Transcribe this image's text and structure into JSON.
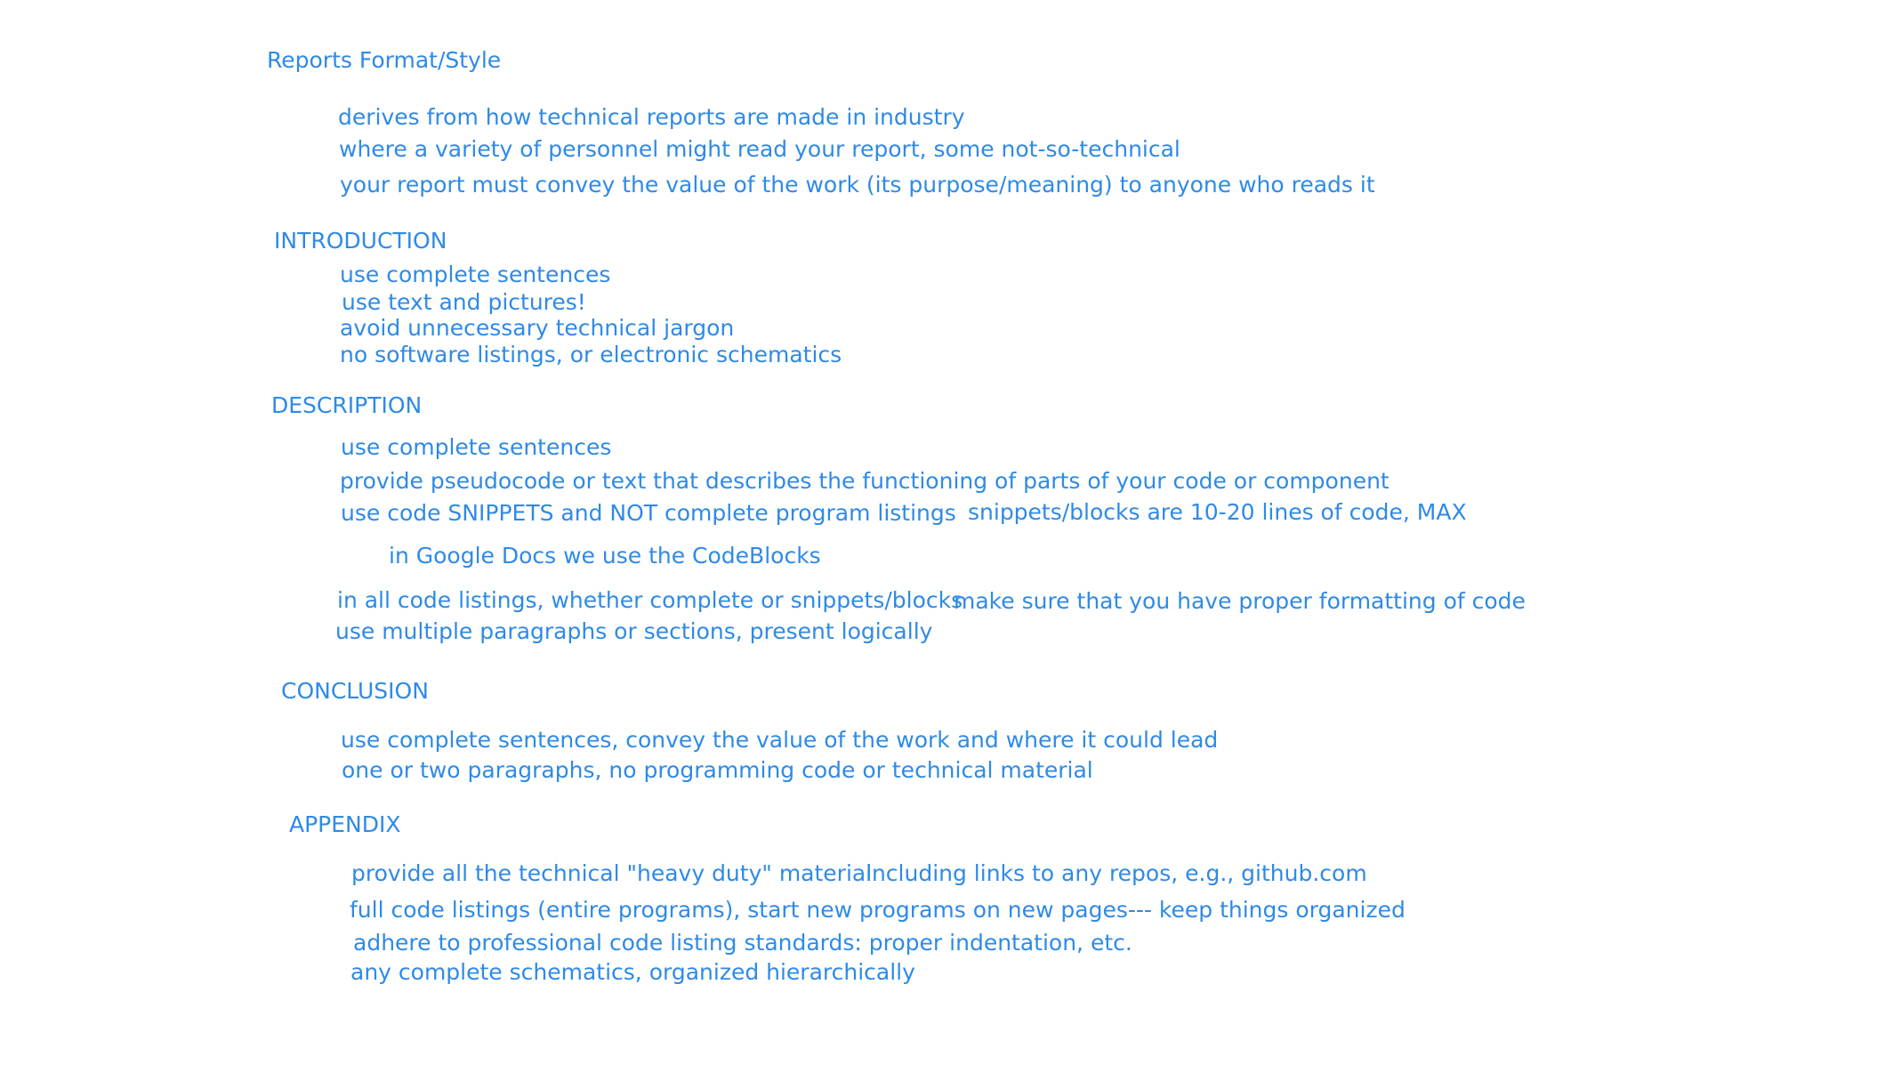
{
  "colors": {
    "text": "#2f8ae6",
    "background": "#ffffff"
  },
  "title": "Reports Format/Style",
  "intro_notes": [
    "derives from how technical reports are made in industry",
    "where a variety of personnel might read your report, some not-so-technical",
    "your report must convey the value of the work (its purpose/meaning) to anyone who reads it"
  ],
  "introduction": {
    "heading": "INTRODUCTION",
    "items": [
      "use complete sentences",
      "use text and pictures!",
      "avoid unnecessary technical jargon",
      "no software listings, or electronic schematics"
    ]
  },
  "description": {
    "heading": "DESCRIPTION",
    "items": [
      "use complete sentences",
      "provide pseudocode or text that describes the functioning of parts of your code or component",
      "use code SNIPPETS and NOT complete program listings",
      "snippets/blocks are 10-20 lines of code, MAX",
      "in Google Docs we use the CodeBlocks",
      "in all code listings, whether complete or snippets/blocks",
      "make sure that you have proper formatting of code",
      "use multiple paragraphs or sections, present logically"
    ]
  },
  "conclusion": {
    "heading": "CONCLUSION",
    "items": [
      "use complete sentences, convey the value of the work and where it could lead",
      "one or two paragraphs, no programming code or technical material"
    ]
  },
  "appendix": {
    "heading": "APPENDIX",
    "items": [
      "provide all the technical \"heavy duty\" material",
      "including links to any repos, e.g., github.com",
      "full code listings (entire programs), start new programs on new pages--- keep things organized",
      "adhere to professional code listing standards: proper indentation, etc.",
      "any complete schematics, organized hierarchically"
    ]
  }
}
